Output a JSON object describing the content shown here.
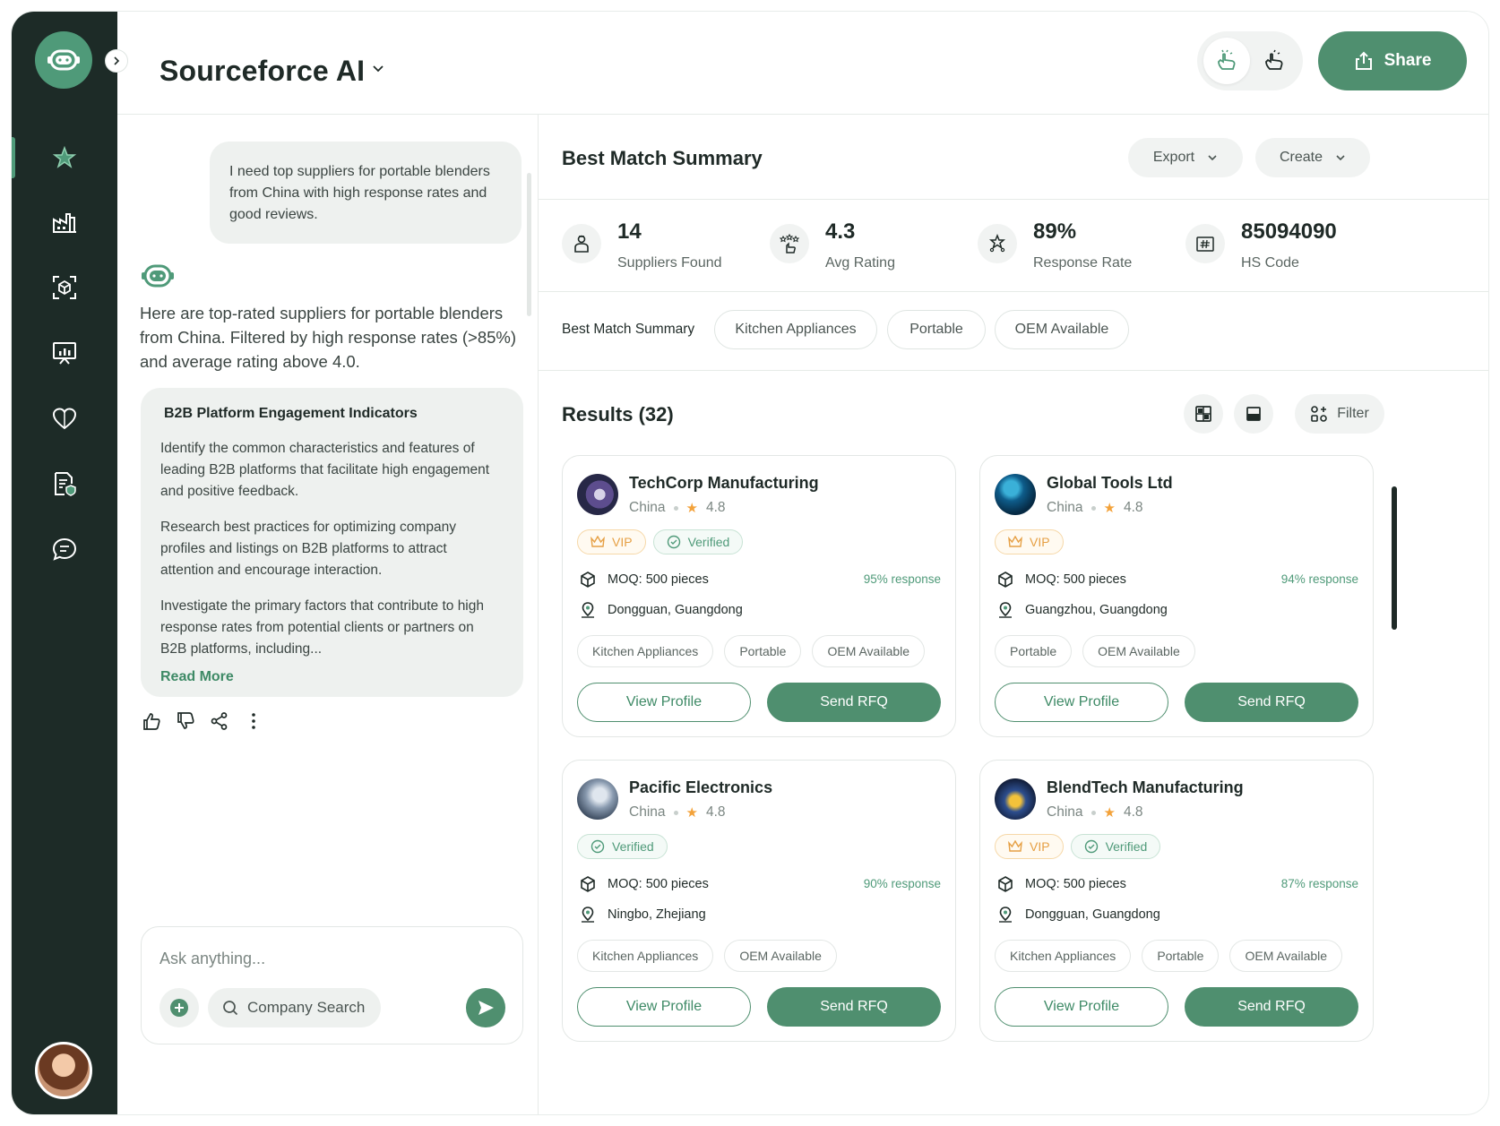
{
  "app": {
    "title": "Sourceforce AI"
  },
  "sidebar": {
    "icons": [
      "sparkle-star-icon",
      "factory-icon",
      "cube-scan-icon",
      "presentation-chart-icon",
      "heart-icon",
      "document-shield-icon",
      "chat-bubble-icon"
    ],
    "active_index": 0
  },
  "header": {
    "share_label": "Share"
  },
  "chat": {
    "user_message": "I need top suppliers for portable blenders from China with high response rates and good reviews.",
    "bot_message": "Here are top-rated suppliers for portable blenders from China. Filtered by high response rates (>85%) and average rating above 4.0.",
    "indicator": {
      "title": "B2B Platform Engagement Indicators",
      "paragraphs": [
        "Identify the common characteristics and features of leading B2B platforms that facilitate high engagement and positive feedback.",
        "Research best practices for optimizing company profiles and listings on B2B platforms to attract attention and encourage interaction.",
        "Investigate the primary factors that contribute to high response rates from potential clients or partners on B2B platforms, including..."
      ],
      "read_more": "Read More"
    },
    "composer": {
      "placeholder": "Ask anything...",
      "company_search": "Company Search"
    }
  },
  "summary": {
    "title": "Best Match Summary",
    "export_label": "Export",
    "create_label": "Create",
    "stats": [
      {
        "value": "14",
        "label": "Suppliers Found"
      },
      {
        "value": "4.3",
        "label": "Avg Rating"
      },
      {
        "value": "89%",
        "label": "Response Rate"
      },
      {
        "value": "85094090",
        "label": "HS Code"
      }
    ],
    "filter_label": "Best Match Summary",
    "chips": [
      "Kitchen Appliances",
      "Portable",
      "OEM Available"
    ]
  },
  "results": {
    "title": "Results (32)",
    "filter_label": "Filter",
    "view_profile_label": "View Profile",
    "send_rfq_label": "Send RFQ",
    "vip_label": "VIP",
    "verified_label": "Verified",
    "suppliers": [
      {
        "name": "TechCorp Manufacturing",
        "country": "China",
        "rating": "4.8",
        "moq": "MOQ: 500 pieces",
        "response": "95% response",
        "location": "Dongguan, Guangdong",
        "tags": [
          "Kitchen Appliances",
          "Portable",
          "OEM Available"
        ]
      },
      {
        "name": "Global Tools Ltd",
        "country": "China",
        "rating": "4.8",
        "moq": "MOQ: 500 pieces",
        "response": "94% response",
        "location": "Guangzhou, Guangdong",
        "tags": [
          "Portable",
          "OEM Available"
        ]
      },
      {
        "name": "Pacific Electronics",
        "country": "China",
        "rating": "4.8",
        "moq": "MOQ: 500 pieces",
        "response": "90% response",
        "location": "Ningbo, Zhejiang",
        "tags": [
          "Kitchen Appliances",
          "OEM Available"
        ]
      },
      {
        "name": "BlendTech Manufacturing",
        "country": "China",
        "rating": "4.8",
        "moq": "MOQ: 500 pieces",
        "response": "87% response",
        "location": "Dongguan, Guangdong",
        "tags": [
          "Kitchen Appliances",
          "Portable",
          "OEM Available"
        ]
      }
    ]
  },
  "colors": {
    "sidebar": "#1d2b27",
    "accent": "#4f8f6f",
    "vip": "#e6a045",
    "star": "#f3a23a"
  }
}
